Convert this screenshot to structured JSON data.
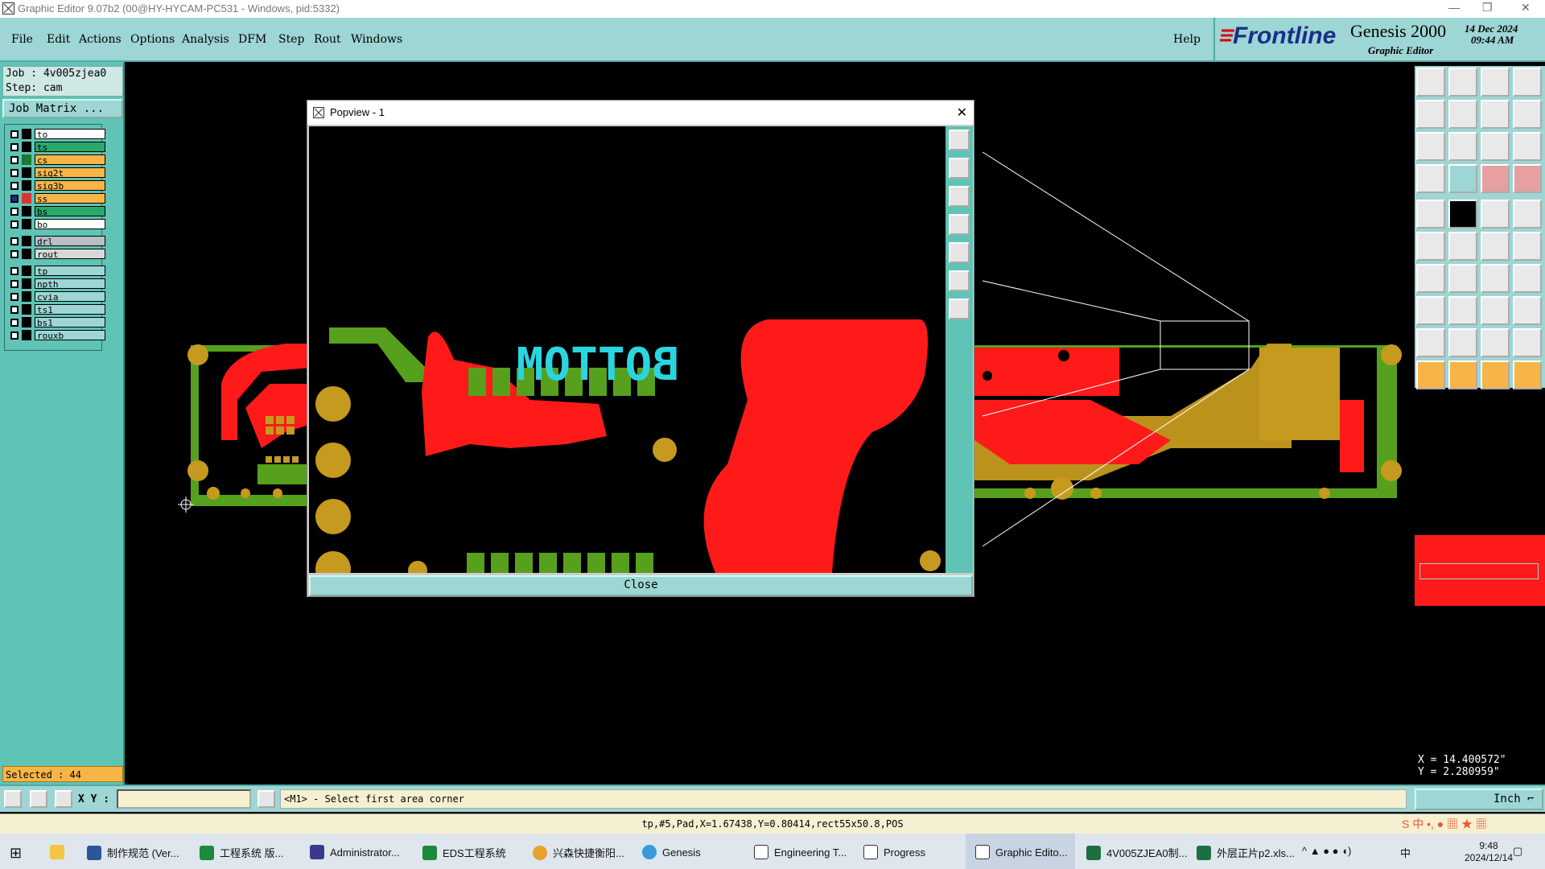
{
  "window": {
    "title": "Graphic Editor 9.07b2 (00@HY-HYCAM-PC531 - Windows, pid:5332)"
  },
  "menu": [
    "File",
    "Edit",
    "Actions",
    "Options",
    "Analysis",
    "DFM",
    "Step",
    "Rout",
    "Windows"
  ],
  "menu_help": "Help",
  "brand": {
    "logo": "Frontline",
    "product": "Genesis 2000",
    "subtitle": "Graphic Editor",
    "date": "14 Dec 2024",
    "time": "09:44 AM"
  },
  "job": {
    "job_line": "Job : 4v005zjea0",
    "step_line": "Step: cam",
    "matrix_button": "Job Matrix ..."
  },
  "layers": [
    {
      "name": "to",
      "color": "#ffffff",
      "checked": false
    },
    {
      "name": "ts",
      "color": "#2aa86a",
      "checked": false
    },
    {
      "name": "cs",
      "color": "#f7b548",
      "checked": false
    },
    {
      "name": "sig2t",
      "color": "#f7b548",
      "checked": false
    },
    {
      "name": "sig3b",
      "color": "#f7b548",
      "checked": false
    },
    {
      "name": "ss",
      "color": "#f7b548",
      "checked": true
    },
    {
      "name": "bs",
      "color": "#2aa86a",
      "checked": false
    },
    {
      "name": "bo",
      "color": "#ffffff",
      "checked": false
    },
    {
      "name": "drl",
      "color": "#b8c0c6",
      "checked": false
    },
    {
      "name": "rout",
      "color": "#d8d8d8",
      "checked": false
    },
    {
      "name": "tp",
      "color": "#9dd6d4",
      "checked": false
    },
    {
      "name": "npth",
      "color": "#9dd6d4",
      "checked": false
    },
    {
      "name": "cvia",
      "color": "#9dd6d4",
      "checked": false
    },
    {
      "name": "ts1",
      "color": "#9dd6d4",
      "checked": false
    },
    {
      "name": "bs1",
      "color": "#9dd6d4",
      "checked": false
    },
    {
      "name": "rouxb",
      "color": "#9dd6d4",
      "checked": false
    }
  ],
  "selected_text": "Selected : 44",
  "popup": {
    "title": "Popview - 1",
    "close_label": "Close",
    "board_text": "BOTTOM"
  },
  "coords": {
    "x": "X = 14.400572\"",
    "y": "Y = 2.280959\""
  },
  "bottom": {
    "xy_label": "X Y :",
    "xy_value": "",
    "prompt": "<M1> - Select first area corner",
    "units": "Inch"
  },
  "status_line": "tp,#5,Pad,X=1.67438,Y=0.80414,rect55x50.8,POS",
  "taskbar": {
    "items": [
      "制作规范 (Ver...",
      "工程系统 版...",
      "Administrator...",
      "EDS工程系统",
      "兴森快捷衡阳...",
      "Genesis",
      "Engineering T...",
      "Progress",
      "Graphic Edito...",
      "4V005ZJEA0制...",
      "外层正片p2.xls..."
    ],
    "clock_time": "9:48",
    "clock_date": "2024/12/14",
    "ime": "中"
  },
  "colors": {
    "teal": "#9dd6d4",
    "panel": "#5fc3b6",
    "copper_red": "#ff1a1a",
    "pad_gold": "#c59a1e",
    "mask_green": "#56a01e",
    "orange": "#f7b548"
  }
}
